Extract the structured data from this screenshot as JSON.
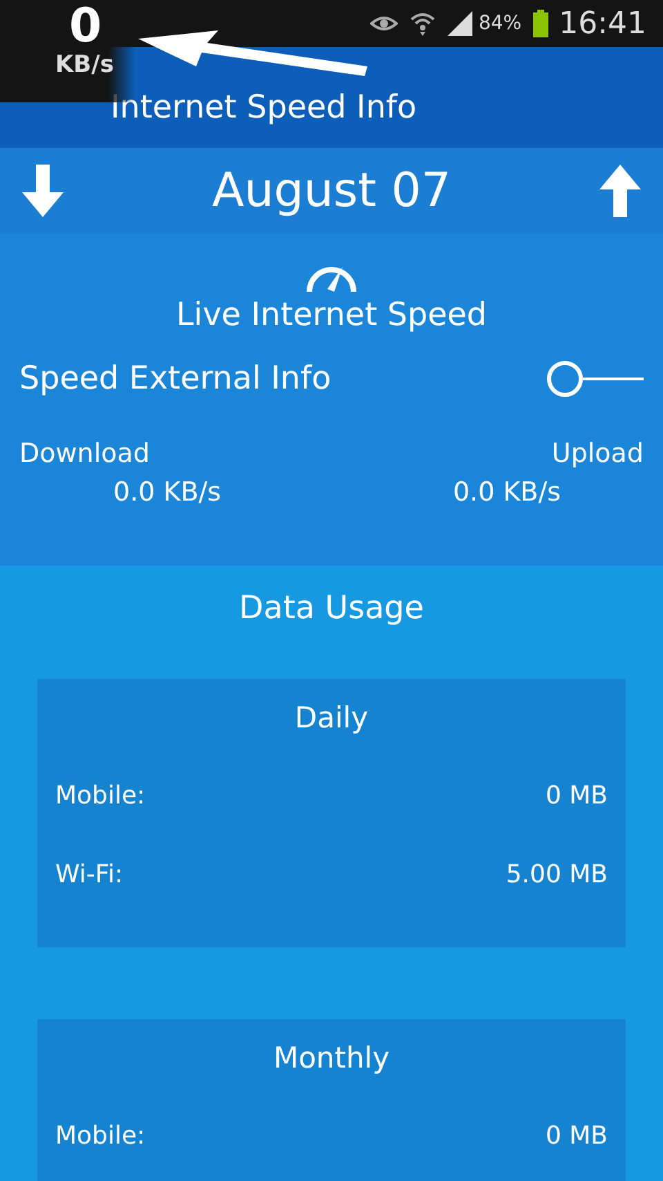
{
  "status_bar": {
    "speed_value": "0",
    "speed_unit": "KB/s",
    "battery": "84%",
    "time": "16:41"
  },
  "app_bar": {
    "title": "Internet Speed Info"
  },
  "date_nav": {
    "date": "August 07"
  },
  "live": {
    "title": "Live Internet Speed",
    "switch_label": "Speed External Info",
    "switch_on": false,
    "download_label": "Download",
    "download_value": "0.0 KB/s",
    "upload_label": "Upload",
    "upload_value": "0.0 KB/s"
  },
  "usage": {
    "title": "Data Usage",
    "cards": [
      {
        "title": "Daily",
        "rows": [
          {
            "label": "Mobile:",
            "value": "0 MB"
          },
          {
            "label": "Wi-Fi:",
            "value": "5.00 MB"
          }
        ]
      },
      {
        "title": "Monthly",
        "rows": [
          {
            "label": "Mobile:",
            "value": "0 MB"
          }
        ]
      }
    ]
  }
}
